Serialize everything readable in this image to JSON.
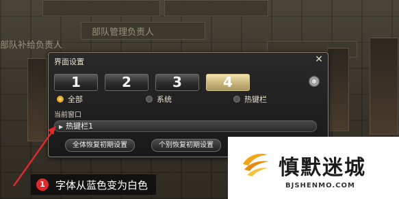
{
  "background": {
    "text_1": "部队补给负责人",
    "text_2": "部队管理负责人"
  },
  "dialog": {
    "title": "界面设置",
    "close_icon": "close-icon",
    "tabs": [
      "1",
      "2",
      "3",
      "4"
    ],
    "active_tab": "4",
    "settings_icon": "gear-icon",
    "radios": [
      {
        "label": "全部",
        "selected": true
      },
      {
        "label": "系统",
        "selected": false
      },
      {
        "label": "热键栏",
        "selected": false
      }
    ],
    "current_window_label": "当前窗口",
    "current_window_value": "热键栏1",
    "reset_all_label": "全体恢复初期设置",
    "reset_single_label": "个别恢复初期设置"
  },
  "annotation": {
    "badge": "1",
    "text": "字体从蓝色变为白色",
    "arrow_color": "#e02a2a"
  },
  "watermark": {
    "title": "慎默迷城",
    "url": "BJSHENMO.COM"
  },
  "colors": {
    "accent_gold": "#c9b47a",
    "radio_on": "#e3a524",
    "annotation_red": "#e02a2a"
  }
}
